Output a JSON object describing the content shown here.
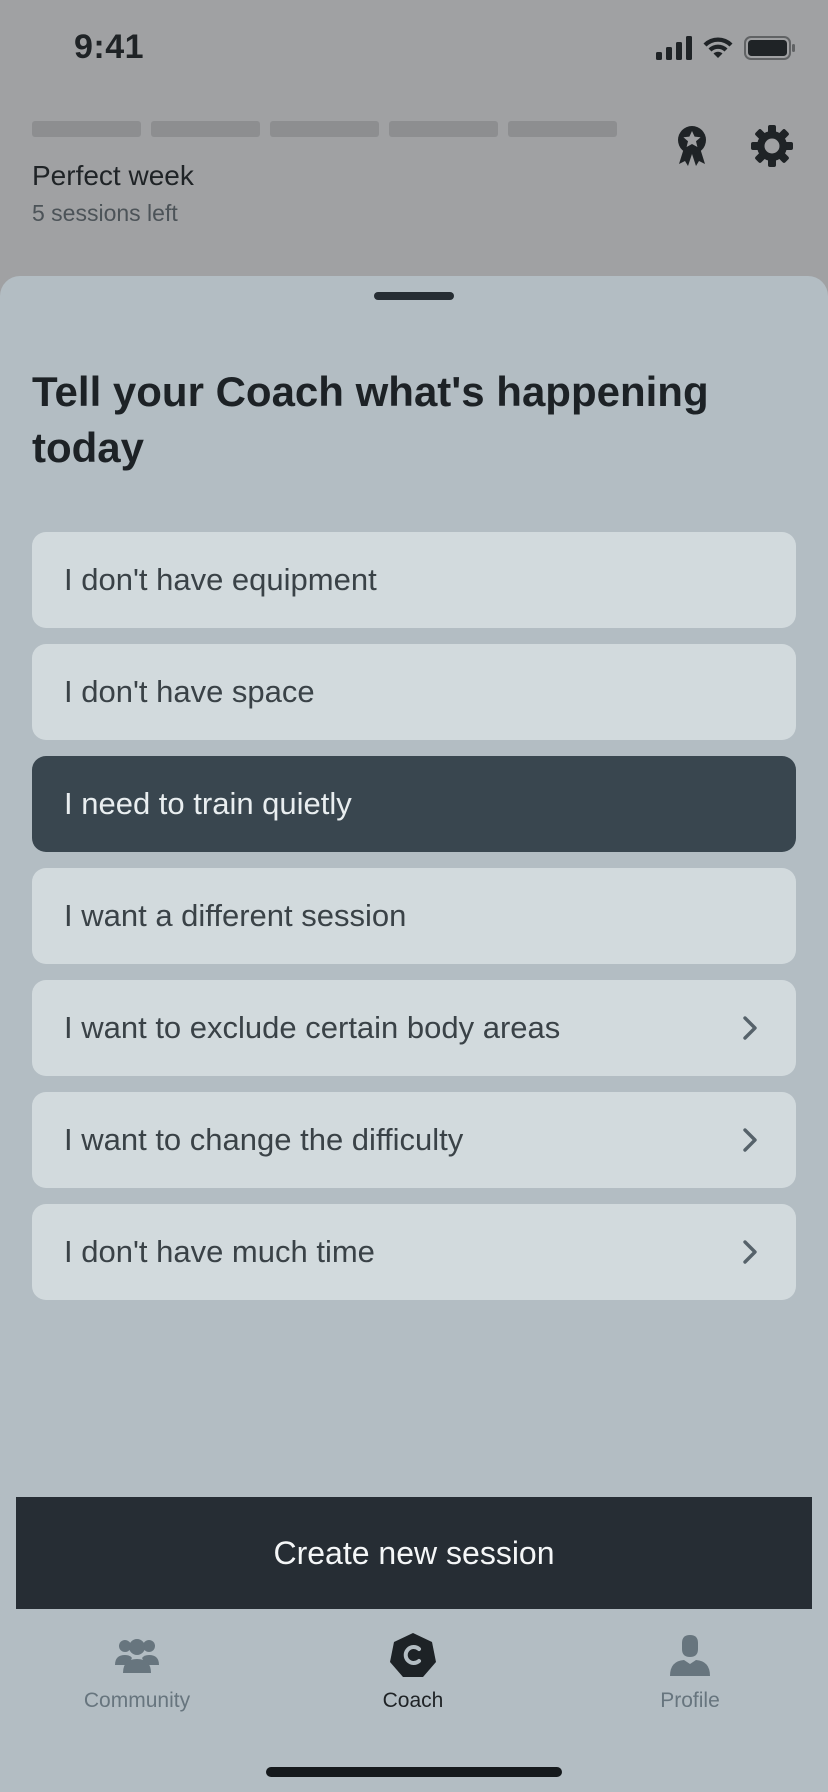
{
  "status_bar": {
    "time": "9:41",
    "icons": [
      "signal-icon",
      "wifi-icon",
      "battery-icon"
    ]
  },
  "header": {
    "progress_segments": 5,
    "goal_title": "Perfect week",
    "goal_subtitle": "5 sessions left",
    "icons": [
      "award-icon",
      "settings-gear-icon"
    ]
  },
  "sheet": {
    "title": "Tell your Coach what's happening today",
    "options": [
      {
        "label": "I don't have equipment",
        "selected": false,
        "has_chevron": false
      },
      {
        "label": "I don't have space",
        "selected": false,
        "has_chevron": false
      },
      {
        "label": "I need to train quietly",
        "selected": true,
        "has_chevron": false
      },
      {
        "label": "I want a different session",
        "selected": false,
        "has_chevron": false
      },
      {
        "label": "I want to exclude certain body areas",
        "selected": false,
        "has_chevron": true
      },
      {
        "label": "I want to change the difficulty",
        "selected": false,
        "has_chevron": true
      },
      {
        "label": "I don't have much time",
        "selected": false,
        "has_chevron": true
      }
    ],
    "primary_button": "Create new session"
  },
  "tab_bar": {
    "tabs": [
      {
        "label": "Community",
        "icon": "community-icon",
        "active": false
      },
      {
        "label": "Coach",
        "icon": "coach-icon",
        "active": true
      },
      {
        "label": "Profile",
        "icon": "profile-icon",
        "active": false
      }
    ]
  },
  "colors": {
    "selected_option_bg": "#39464f",
    "option_bg": "#d2dadd",
    "sheet_bg": "#b3bdc3",
    "button_bg": "#262d34"
  }
}
